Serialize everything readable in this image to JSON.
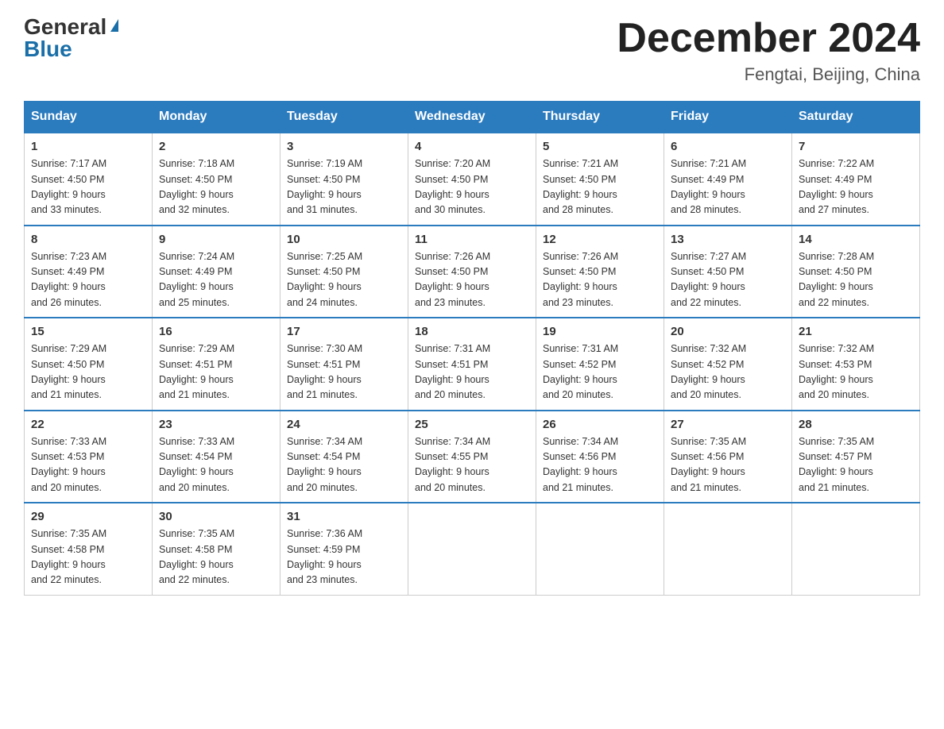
{
  "logo": {
    "general": "General",
    "blue": "Blue",
    "triangle": "▶"
  },
  "title": "December 2024",
  "location": "Fengtai, Beijing, China",
  "days_of_week": [
    "Sunday",
    "Monday",
    "Tuesday",
    "Wednesday",
    "Thursday",
    "Friday",
    "Saturday"
  ],
  "weeks": [
    [
      {
        "day": "1",
        "sunrise": "7:17 AM",
        "sunset": "4:50 PM",
        "daylight": "9 hours and 33 minutes."
      },
      {
        "day": "2",
        "sunrise": "7:18 AM",
        "sunset": "4:50 PM",
        "daylight": "9 hours and 32 minutes."
      },
      {
        "day": "3",
        "sunrise": "7:19 AM",
        "sunset": "4:50 PM",
        "daylight": "9 hours and 31 minutes."
      },
      {
        "day": "4",
        "sunrise": "7:20 AM",
        "sunset": "4:50 PM",
        "daylight": "9 hours and 30 minutes."
      },
      {
        "day": "5",
        "sunrise": "7:21 AM",
        "sunset": "4:50 PM",
        "daylight": "9 hours and 28 minutes."
      },
      {
        "day": "6",
        "sunrise": "7:21 AM",
        "sunset": "4:49 PM",
        "daylight": "9 hours and 28 minutes."
      },
      {
        "day": "7",
        "sunrise": "7:22 AM",
        "sunset": "4:49 PM",
        "daylight": "9 hours and 27 minutes."
      }
    ],
    [
      {
        "day": "8",
        "sunrise": "7:23 AM",
        "sunset": "4:49 PM",
        "daylight": "9 hours and 26 minutes."
      },
      {
        "day": "9",
        "sunrise": "7:24 AM",
        "sunset": "4:49 PM",
        "daylight": "9 hours and 25 minutes."
      },
      {
        "day": "10",
        "sunrise": "7:25 AM",
        "sunset": "4:50 PM",
        "daylight": "9 hours and 24 minutes."
      },
      {
        "day": "11",
        "sunrise": "7:26 AM",
        "sunset": "4:50 PM",
        "daylight": "9 hours and 23 minutes."
      },
      {
        "day": "12",
        "sunrise": "7:26 AM",
        "sunset": "4:50 PM",
        "daylight": "9 hours and 23 minutes."
      },
      {
        "day": "13",
        "sunrise": "7:27 AM",
        "sunset": "4:50 PM",
        "daylight": "9 hours and 22 minutes."
      },
      {
        "day": "14",
        "sunrise": "7:28 AM",
        "sunset": "4:50 PM",
        "daylight": "9 hours and 22 minutes."
      }
    ],
    [
      {
        "day": "15",
        "sunrise": "7:29 AM",
        "sunset": "4:50 PM",
        "daylight": "9 hours and 21 minutes."
      },
      {
        "day": "16",
        "sunrise": "7:29 AM",
        "sunset": "4:51 PM",
        "daylight": "9 hours and 21 minutes."
      },
      {
        "day": "17",
        "sunrise": "7:30 AM",
        "sunset": "4:51 PM",
        "daylight": "9 hours and 21 minutes."
      },
      {
        "day": "18",
        "sunrise": "7:31 AM",
        "sunset": "4:51 PM",
        "daylight": "9 hours and 20 minutes."
      },
      {
        "day": "19",
        "sunrise": "7:31 AM",
        "sunset": "4:52 PM",
        "daylight": "9 hours and 20 minutes."
      },
      {
        "day": "20",
        "sunrise": "7:32 AM",
        "sunset": "4:52 PM",
        "daylight": "9 hours and 20 minutes."
      },
      {
        "day": "21",
        "sunrise": "7:32 AM",
        "sunset": "4:53 PM",
        "daylight": "9 hours and 20 minutes."
      }
    ],
    [
      {
        "day": "22",
        "sunrise": "7:33 AM",
        "sunset": "4:53 PM",
        "daylight": "9 hours and 20 minutes."
      },
      {
        "day": "23",
        "sunrise": "7:33 AM",
        "sunset": "4:54 PM",
        "daylight": "9 hours and 20 minutes."
      },
      {
        "day": "24",
        "sunrise": "7:34 AM",
        "sunset": "4:54 PM",
        "daylight": "9 hours and 20 minutes."
      },
      {
        "day": "25",
        "sunrise": "7:34 AM",
        "sunset": "4:55 PM",
        "daylight": "9 hours and 20 minutes."
      },
      {
        "day": "26",
        "sunrise": "7:34 AM",
        "sunset": "4:56 PM",
        "daylight": "9 hours and 21 minutes."
      },
      {
        "day": "27",
        "sunrise": "7:35 AM",
        "sunset": "4:56 PM",
        "daylight": "9 hours and 21 minutes."
      },
      {
        "day": "28",
        "sunrise": "7:35 AM",
        "sunset": "4:57 PM",
        "daylight": "9 hours and 21 minutes."
      }
    ],
    [
      {
        "day": "29",
        "sunrise": "7:35 AM",
        "sunset": "4:58 PM",
        "daylight": "9 hours and 22 minutes."
      },
      {
        "day": "30",
        "sunrise": "7:35 AM",
        "sunset": "4:58 PM",
        "daylight": "9 hours and 22 minutes."
      },
      {
        "day": "31",
        "sunrise": "7:36 AM",
        "sunset": "4:59 PM",
        "daylight": "9 hours and 23 minutes."
      },
      null,
      null,
      null,
      null
    ]
  ],
  "labels": {
    "sunrise": "Sunrise:",
    "sunset": "Sunset:",
    "daylight": "Daylight:"
  }
}
